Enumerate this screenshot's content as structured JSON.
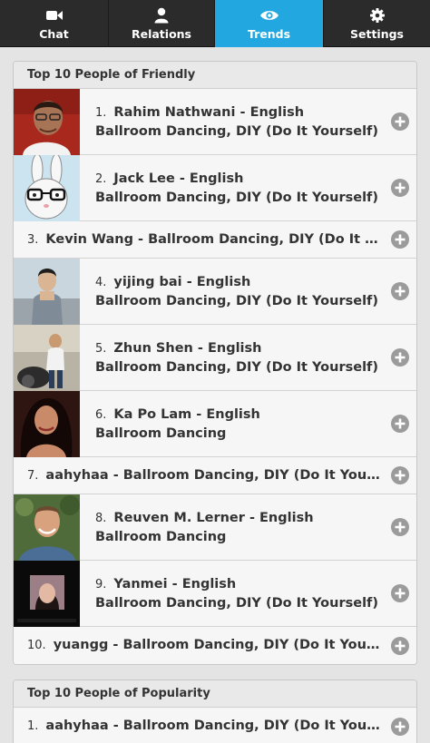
{
  "tabs": [
    {
      "label": "Chat",
      "icon": "video-camera-icon",
      "active": false
    },
    {
      "label": "Relations",
      "icon": "person-icon",
      "active": false
    },
    {
      "label": "Trends",
      "icon": "eye-icon",
      "active": true
    },
    {
      "label": "Settings",
      "icon": "gear-icon",
      "active": false
    }
  ],
  "colors": {
    "tab_bar": "#2b2b2b",
    "active_tab": "#22a7e0",
    "add_button": "#9b9b9b"
  },
  "friendly": {
    "title": "Top 10 People of Friendly",
    "items": [
      {
        "rank": "1.",
        "name": "Rahim Nathwani - English",
        "line2": "Ballroom Dancing, DIY (Do It Yourself)"
      },
      {
        "rank": "2.",
        "name": "Jack Lee - English",
        "line2": "Ballroom Dancing, DIY (Do It Yourself)"
      },
      {
        "rank": "3.",
        "name": "Kevin Wang - Ballroom Dancing, DIY (Do It Yourself)"
      },
      {
        "rank": "4.",
        "name": "yijing bai - English",
        "line2": "Ballroom Dancing, DIY (Do It Yourself)"
      },
      {
        "rank": "5.",
        "name": "Zhun Shen - English",
        "line2": "Ballroom Dancing, DIY (Do It Yourself)"
      },
      {
        "rank": "6.",
        "name": "Ka Po Lam - English",
        "line2": "Ballroom Dancing"
      },
      {
        "rank": "7.",
        "name": "aahyhaa - Ballroom Dancing, DIY (Do It Yourself)"
      },
      {
        "rank": "8.",
        "name": "Reuven M. Lerner - English",
        "line2": "Ballroom Dancing"
      },
      {
        "rank": "9.",
        "name": "Yanmei - English",
        "line2": "Ballroom Dancing, DIY (Do It Yourself)"
      },
      {
        "rank": "10.",
        "name": "yuangg - Ballroom Dancing, DIY (Do It Yourself)"
      }
    ]
  },
  "popularity": {
    "title": "Top 10 People of Popularity",
    "items": [
      {
        "rank": "1.",
        "name": "aahyhaa - Ballroom Dancing, DIY (Do It Yourself)"
      }
    ]
  }
}
